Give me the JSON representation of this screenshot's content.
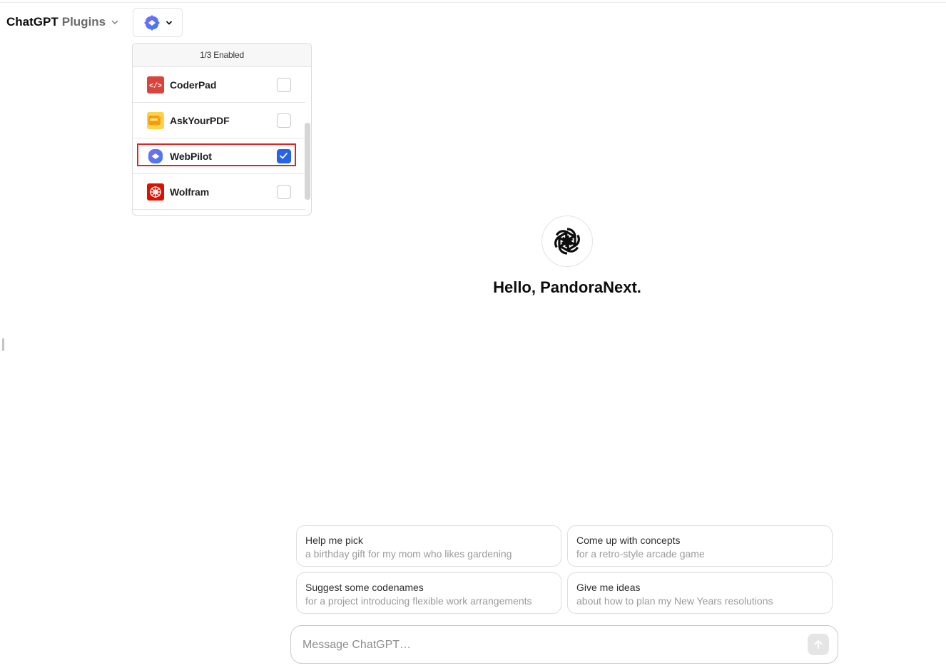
{
  "header": {
    "model_name": "ChatGPT",
    "model_variant": "Plugins",
    "chevron_icon": "chevron-down-icon",
    "plugin_toggle_icon": "webpilot-icon"
  },
  "plugins_dropdown": {
    "header": "1/3 Enabled",
    "items": [
      {
        "label": "CoderPad",
        "icon": "coderpad-icon",
        "checked": false,
        "color": "#d9453d"
      },
      {
        "label": "AskYourPDF",
        "icon": "askyourpdf-icon",
        "checked": false,
        "color": "#f5b324"
      },
      {
        "label": "WebPilot",
        "icon": "webpilot-icon",
        "checked": true,
        "highlighted": true,
        "color": "#5b5ff3"
      },
      {
        "label": "Wolfram",
        "icon": "wolfram-icon",
        "checked": false,
        "color": "#dd1100"
      }
    ]
  },
  "main": {
    "logo_icon": "openai-logo-icon",
    "greeting": "Hello, PandoraNext."
  },
  "suggestions": [
    {
      "title": "Help me pick",
      "subtitle": "a birthday gift for my mom who likes gardening"
    },
    {
      "title": "Come up with concepts",
      "subtitle": "for a retro-style arcade game"
    },
    {
      "title": "Suggest some codenames",
      "subtitle": "for a project introducing flexible work arrangements"
    },
    {
      "title": "Give me ideas",
      "subtitle": "about how to plan my New Years resolutions"
    }
  ],
  "composer": {
    "placeholder": "Message ChatGPT…",
    "value": "",
    "send_icon": "arrow-up-icon"
  },
  "colors": {
    "accent": "#2563eb",
    "highlight_outline": "#e02424",
    "send_disabled": "#e5e5e5"
  }
}
